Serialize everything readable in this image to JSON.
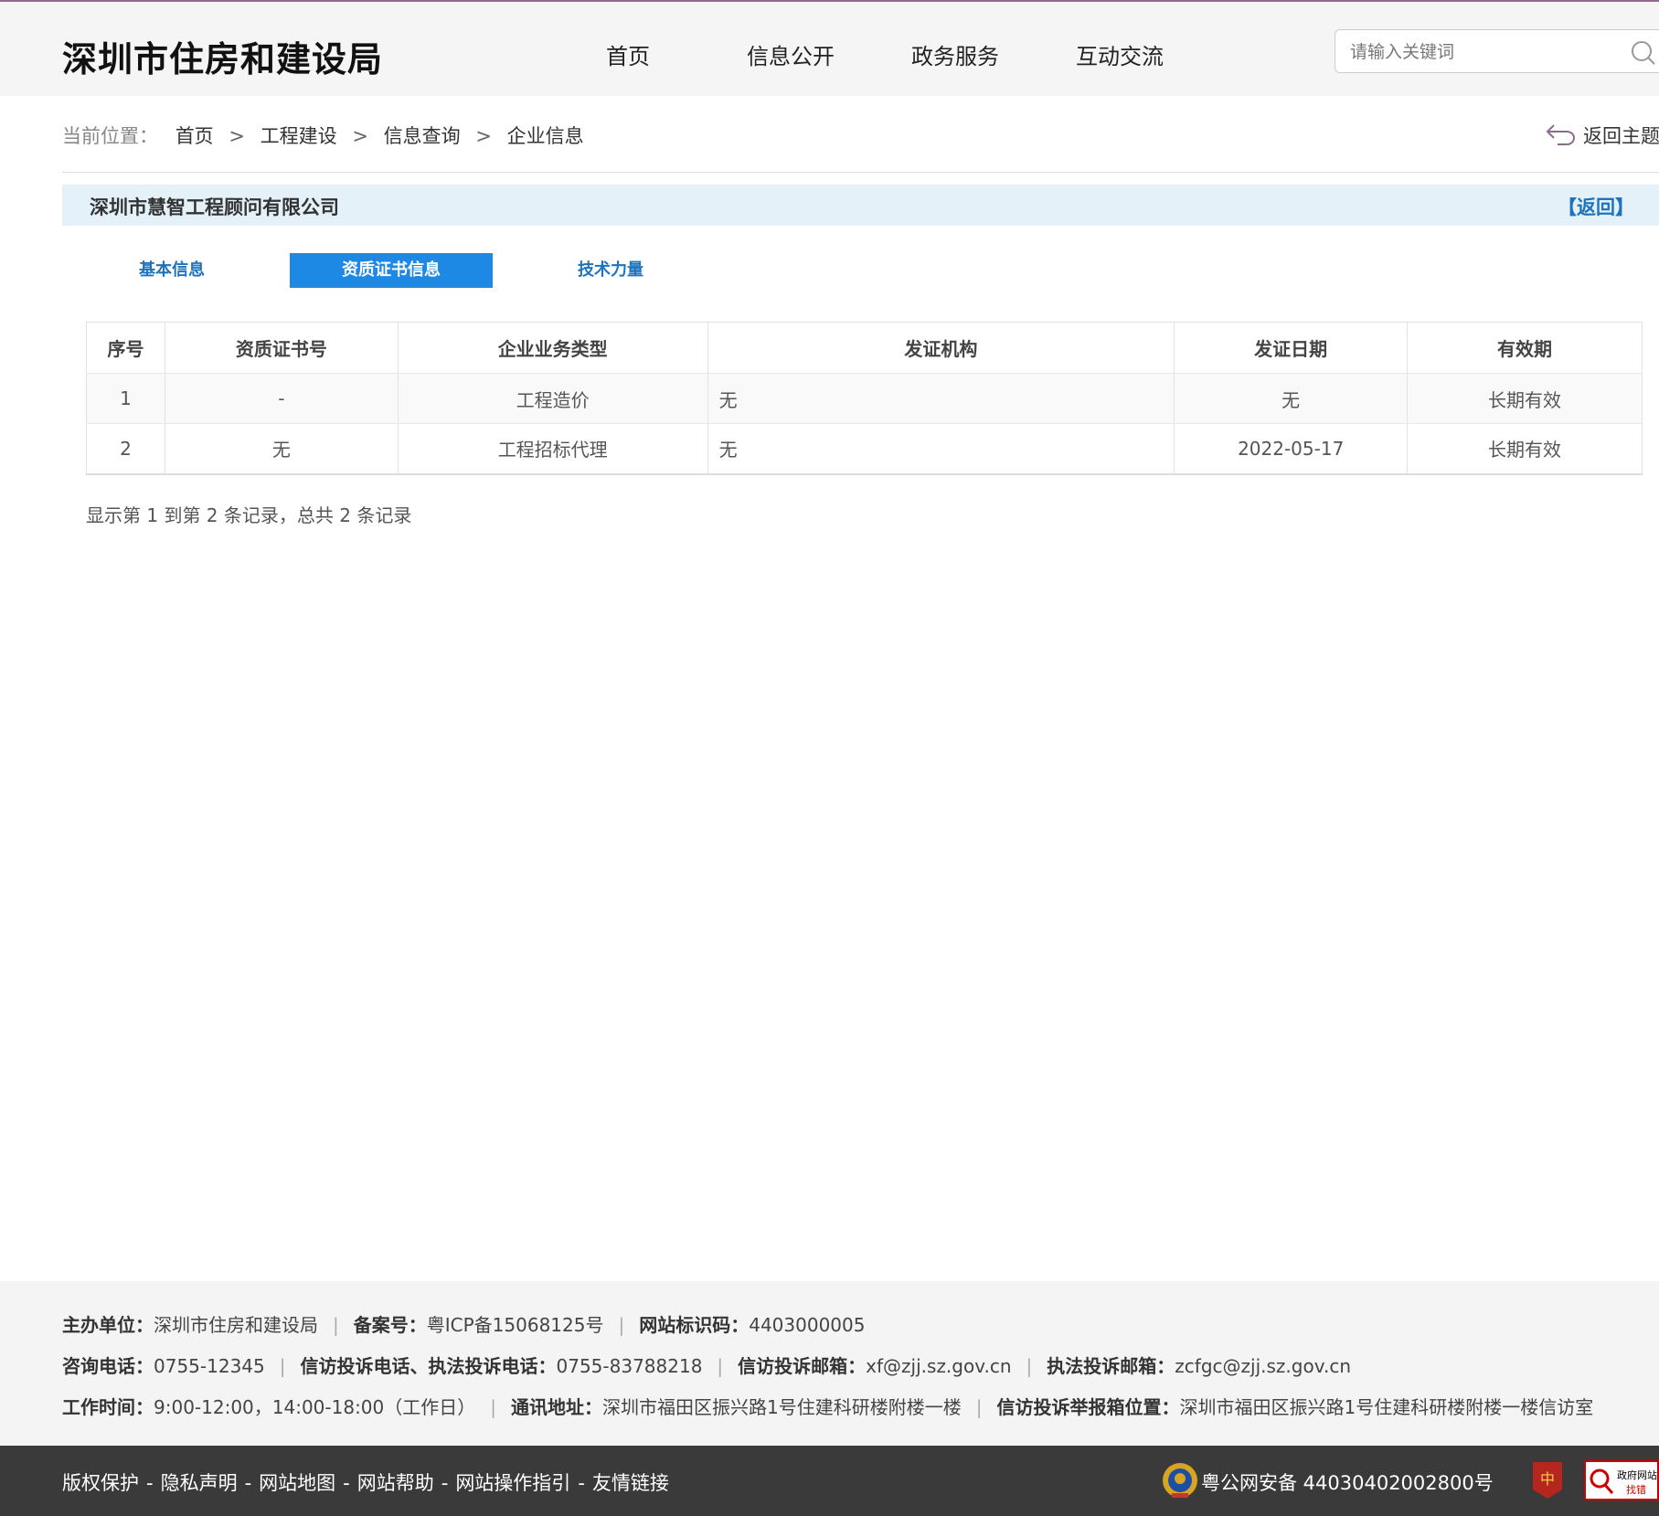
{
  "header": {
    "site_title": "深圳市住房和建设局",
    "nav": [
      "首页",
      "信息公开",
      "政务服务",
      "互动交流"
    ],
    "search_placeholder": "请输入关键词"
  },
  "breadcrumb": {
    "label": "当前位置：",
    "items": [
      "首页",
      "工程建设",
      "信息查询",
      "企业信息"
    ],
    "separator": ">",
    "back_topic": "返回主题"
  },
  "company": {
    "name": "深圳市慧智工程顾问有限公司",
    "back_label": "【返回】"
  },
  "tabs": [
    {
      "label": "基本信息",
      "active": false
    },
    {
      "label": "资质证书信息",
      "active": true
    },
    {
      "label": "技术力量",
      "active": false
    }
  ],
  "table": {
    "headers": [
      "序号",
      "资质证书号",
      "企业业务类型",
      "发证机构",
      "发证日期",
      "有效期"
    ],
    "rows": [
      [
        "1",
        "-",
        "工程造价",
        "无",
        "无",
        "长期有效"
      ],
      [
        "2",
        "无",
        "工程招标代理",
        "无",
        "2022-05-17",
        "长期有效"
      ]
    ]
  },
  "record_info": "显示第 1 到第 2 条记录，总共 2 条记录",
  "footer": {
    "host_label": "主办单位：",
    "host_value": "深圳市住房和建设局",
    "icp_label": "备案号：",
    "icp_value": "粤ICP备15068125号",
    "site_id_label": "网站标识码：",
    "site_id_value": "4403000005",
    "phone_label": "咨询电话：",
    "phone_value": "0755-12345",
    "complaint_phone_label": "信访投诉电话、执法投诉电话：",
    "complaint_phone_value": "0755-83788218",
    "complaint_mail_label": "信访投诉邮箱：",
    "complaint_mail_value": "xf@zjj.sz.gov.cn",
    "law_mail_label": "执法投诉邮箱：",
    "law_mail_value": "zcfgc@zjj.sz.gov.cn",
    "hours_label": "工作时间：",
    "hours_value": "9:00-12:00，14:00-18:00（工作日）",
    "address_label": "通讯地址：",
    "address_value": "深圳市福田区振兴路1号住建科研楼附楼一楼",
    "box_label": "信访投诉举报箱位置：",
    "box_value": "深圳市福田区振兴路1号住建科研楼附楼一楼信访室",
    "links": [
      "版权保护",
      "隐私声明",
      "网站地图",
      "网站帮助",
      "网站操作指引",
      "友情链接"
    ],
    "police": "粤公网安备 44030402002800号",
    "gov_badge_line1": "政府网站",
    "gov_badge_line2": "找错"
  },
  "colors": {
    "accent": "#1e88e5",
    "link": "#1e73be",
    "company_bar": "#e5f1f8",
    "footer_dark": "#3a3a3a"
  },
  "icons": [
    "search-icon",
    "return-arrow-icon",
    "police-emblem-icon",
    "party-badge-icon",
    "gov-error-badge-icon"
  ]
}
